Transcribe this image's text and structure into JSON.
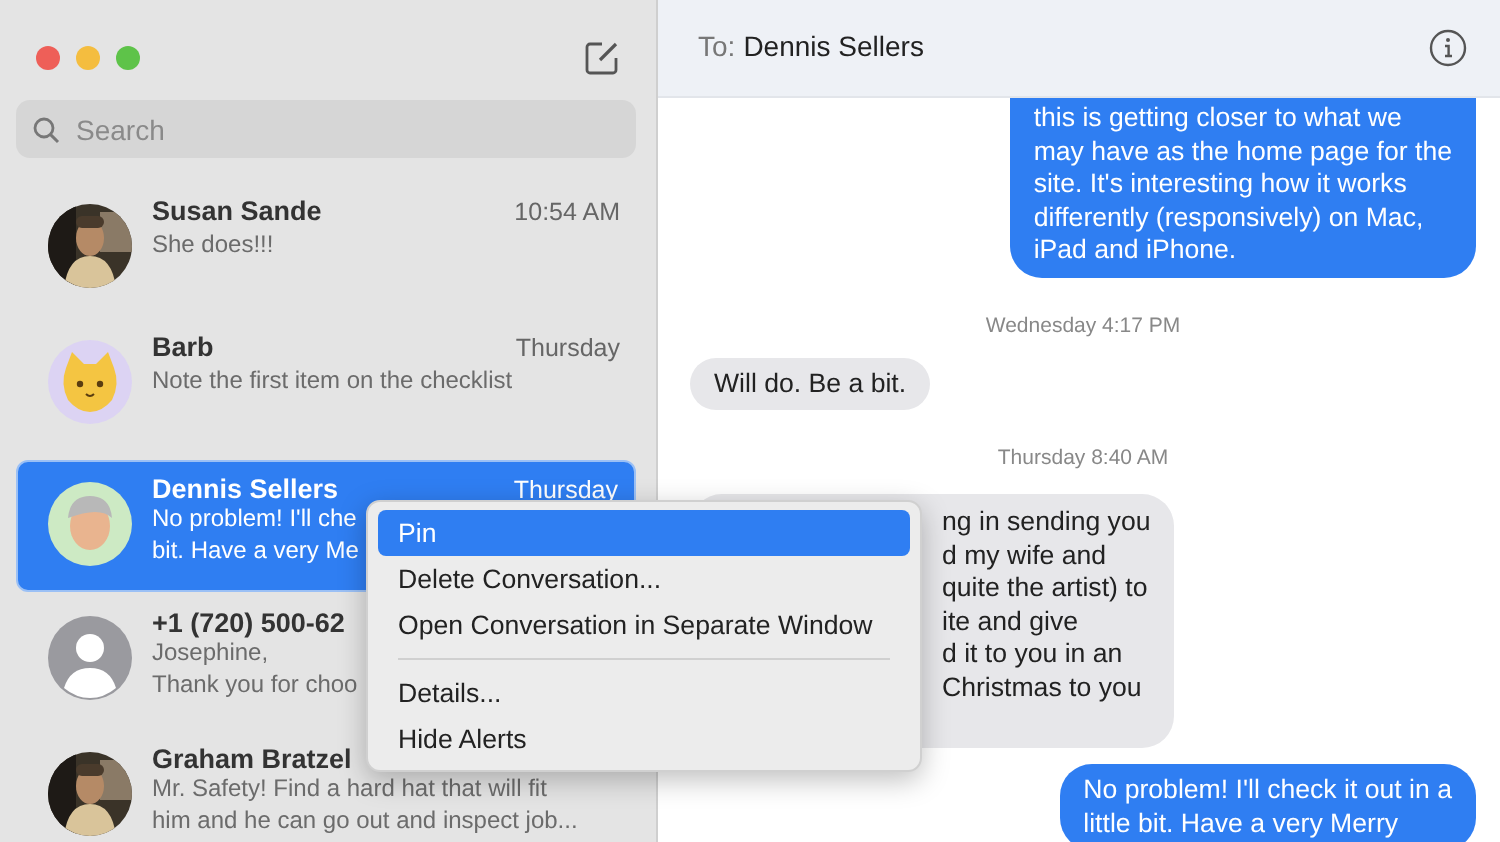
{
  "sidebar": {
    "search": {
      "placeholder": "Search"
    },
    "conversations": [
      {
        "name": "Susan Sande",
        "time": "10:54 AM",
        "preview": [
          "She does!!!"
        ],
        "selected": false
      },
      {
        "name": "Barb",
        "time": "Thursday",
        "preview": [
          "Note the first item on the checklist"
        ],
        "selected": false,
        "kind": "cat"
      },
      {
        "name": "Dennis Sellers",
        "time": "Thursday",
        "preview": [
          "No problem! I'll che",
          "bit. Have a very Me"
        ],
        "selected": true,
        "kind": "memoji"
      },
      {
        "name": "+1 (720) 500-62",
        "preview": [
          "Josephine,",
          "Thank you for choo"
        ],
        "selected": false,
        "kind": "default"
      },
      {
        "name": "Graham Bratzel",
        "preview": [
          "Mr. Safety! Find a hard hat that will fit",
          "him and he can go out and inspect job..."
        ],
        "selected": false
      }
    ]
  },
  "chat": {
    "to_label": "To:",
    "recipient": "Dennis Sellers",
    "messages": [
      {
        "kind": "sent",
        "lines": [
          "this is getting closer to what we",
          "may have as the home page for the",
          "site. It's interesting how it works",
          "differently (responsively) on Mac,",
          "iPad and iPhone."
        ]
      },
      {
        "kind": "timestamp",
        "lines": [
          "Wednesday 4:17 PM"
        ]
      },
      {
        "kind": "received",
        "lines": [
          "Will do. Be a bit."
        ]
      },
      {
        "kind": "timestamp",
        "lines": [
          "Thursday 8:40 AM"
        ]
      },
      {
        "kind": "received_covered",
        "lines": [
          "ng in sending you",
          "d my wife and",
          "quite the artist) to",
          "ite and give",
          "d it to you in an",
          "Christmas to you"
        ]
      },
      {
        "kind": "sent",
        "lines": [
          "No problem! I'll check it out in a",
          "little bit. Have a very Merry"
        ]
      }
    ]
  },
  "context_menu": {
    "groups": [
      [
        {
          "label": "Pin",
          "selected": true
        },
        {
          "label": "Delete Conversation...",
          "selected": false
        },
        {
          "label": "Open Conversation in Separate Window",
          "selected": false
        }
      ],
      [
        {
          "label": "Details...",
          "selected": false
        },
        {
          "label": "Hide Alerts",
          "selected": false
        }
      ]
    ]
  }
}
